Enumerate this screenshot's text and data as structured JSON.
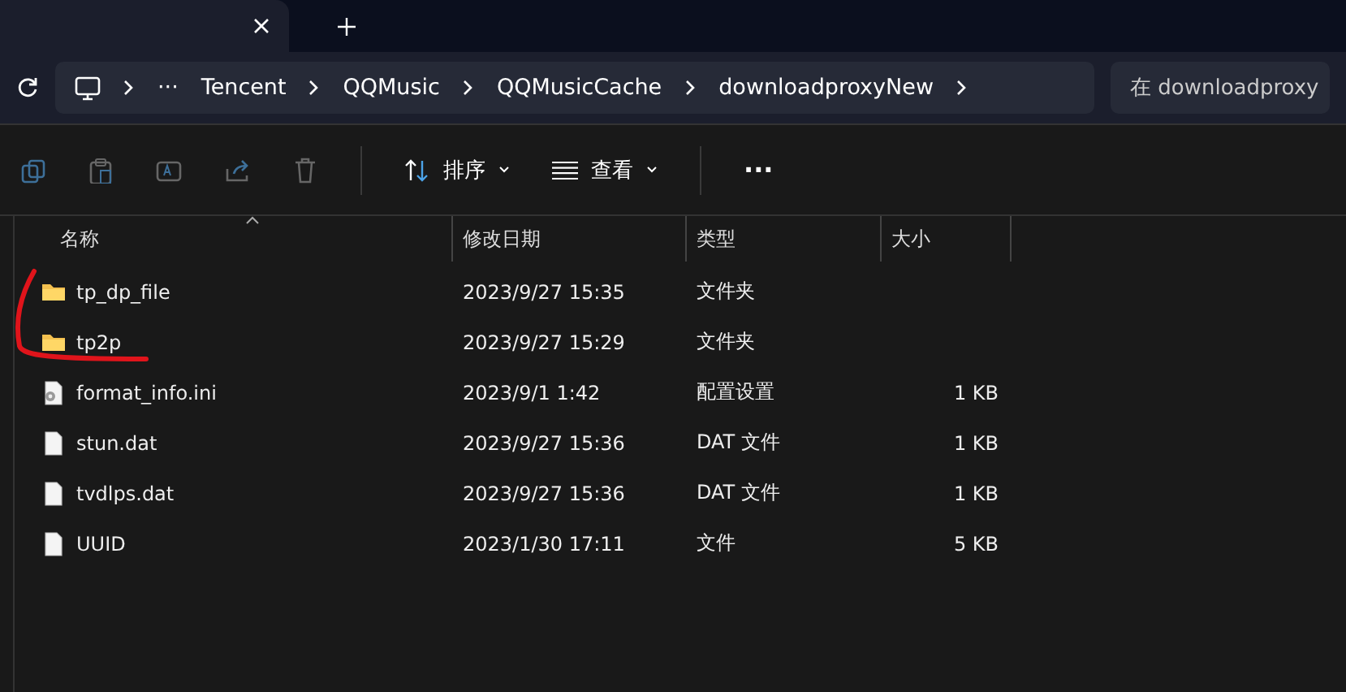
{
  "address_bar": {
    "ellipsis": "···",
    "crumbs": [
      "Tencent",
      "QQMusic",
      "QQMusicCache",
      "downloadproxyNew"
    ]
  },
  "search": {
    "placeholder": "在 downloadproxy"
  },
  "toolbar": {
    "sort": "排序",
    "view": "查看",
    "more": "···"
  },
  "table": {
    "columns": [
      "名称",
      "修改日期",
      "类型",
      "大小"
    ],
    "rows": [
      {
        "kind": "folder",
        "name": "tp_dp_file",
        "date": "2023/9/27 15:35",
        "type": "文件夹"
      },
      {
        "kind": "folder",
        "name": "tp2p",
        "date": "2023/9/27 15:29",
        "type": "文件夹"
      },
      {
        "kind": "settings",
        "name": "format_info.ini",
        "date": "2023/9/1 1:42",
        "type": "配置设置",
        "size": "1 KB"
      },
      {
        "kind": "file",
        "name": "stun.dat",
        "date": "2023/9/27 15:36",
        "type": "DAT 文件",
        "size": "1 KB"
      },
      {
        "kind": "file",
        "name": "tvdlps.dat",
        "date": "2023/9/27 15:36",
        "type": "DAT 文件",
        "size": "1 KB"
      },
      {
        "kind": "file",
        "name": "UUID",
        "date": "2023/1/30 17:11",
        "type": "文件",
        "size": "5 KB"
      }
    ]
  }
}
